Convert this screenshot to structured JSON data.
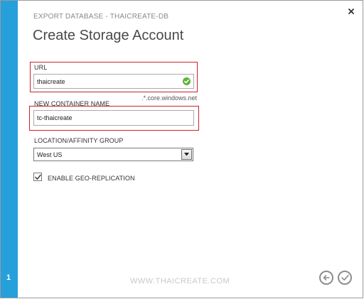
{
  "dialog": {
    "breadcrumb": "EXPORT DATABASE - THAICREATE-DB",
    "title": "Create Storage Account",
    "step_number": "1",
    "close_icon": "close-icon"
  },
  "form": {
    "url": {
      "label": "URL",
      "value": "thaicreate",
      "suffix": ".*.core.windows.net",
      "status_icon": "check-circle-icon",
      "status_color": "#5fb13a"
    },
    "container": {
      "label": "NEW CONTAINER NAME",
      "value": "tc-thaicreate"
    },
    "location": {
      "label": "LOCATION/AFFINITY GROUP",
      "selected": "West US"
    },
    "geo_replication": {
      "label": "ENABLE GEO-REPLICATION",
      "checked": true
    }
  },
  "footer": {
    "watermark": "WWW.THAICREATE.COM",
    "back_icon": "back-arrow-icon",
    "confirm_icon": "checkmark-icon"
  },
  "colors": {
    "accent": "#25a0da",
    "highlight": "#c8232c"
  }
}
